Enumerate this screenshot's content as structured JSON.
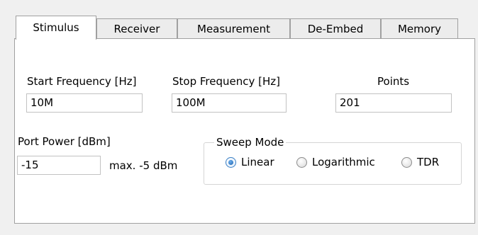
{
  "tabs": [
    {
      "label": "Stimulus",
      "active": true
    },
    {
      "label": "Receiver",
      "active": false
    },
    {
      "label": "Measurement",
      "active": false
    },
    {
      "label": "De-Embed",
      "active": false
    },
    {
      "label": "Memory",
      "active": false
    }
  ],
  "stimulus": {
    "start_frequency": {
      "label": "Start Frequency [Hz]",
      "value": "10M"
    },
    "stop_frequency": {
      "label": "Stop Frequency [Hz]",
      "value": "100M"
    },
    "points": {
      "label": "Points",
      "value": "201"
    },
    "port_power": {
      "label": "Port  Power [dBm]",
      "value": "-15",
      "hint": "max. -5 dBm"
    },
    "sweep_mode": {
      "title": "Sweep Mode",
      "options": [
        {
          "label": "Linear",
          "selected": true
        },
        {
          "label": "Logarithmic",
          "selected": false
        },
        {
          "label": "TDR",
          "selected": false
        }
      ]
    }
  },
  "colors": {
    "window_bg": "#f0f0f0",
    "panel_bg": "#ffffff",
    "border": "#a0a0a0",
    "radio_selected": "#1f5fa8"
  }
}
